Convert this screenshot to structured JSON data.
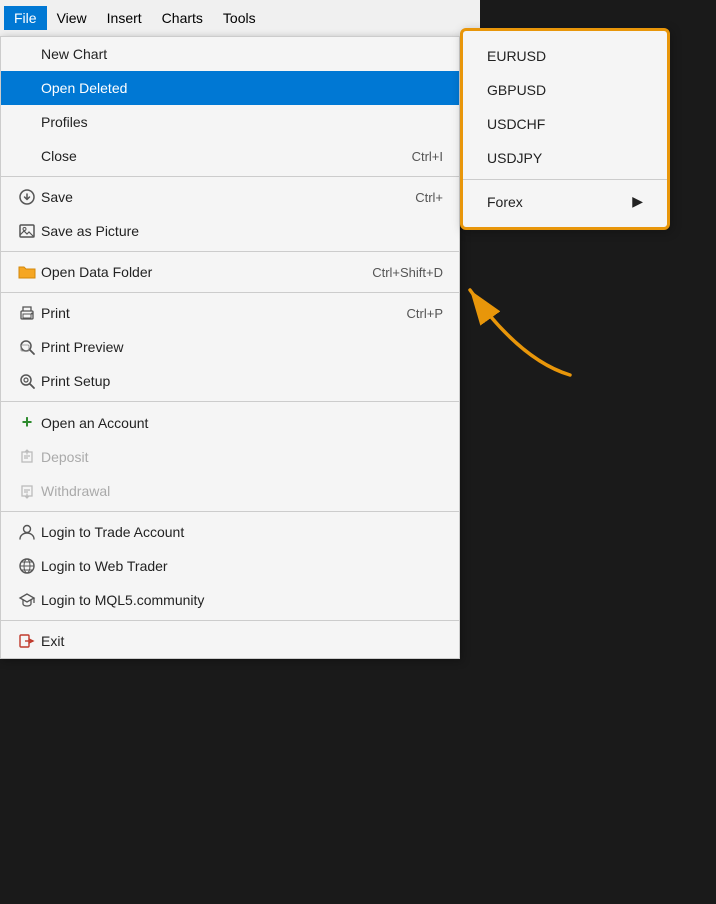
{
  "menubar": {
    "items": [
      {
        "label": "File",
        "active": true
      },
      {
        "label": "View",
        "active": false
      },
      {
        "label": "Insert",
        "active": false
      },
      {
        "label": "Charts",
        "active": false
      },
      {
        "label": "Tools",
        "active": false
      }
    ]
  },
  "dropdown": {
    "items": [
      {
        "id": "new-chart",
        "label": "New Chart",
        "shortcut": "",
        "icon": "",
        "selected": false,
        "disabled": false,
        "separator_after": false
      },
      {
        "id": "open-deleted",
        "label": "Open Deleted",
        "shortcut": "",
        "icon": "",
        "selected": true,
        "disabled": false,
        "separator_after": false
      },
      {
        "id": "profiles",
        "label": "Profiles",
        "shortcut": "",
        "icon": "",
        "selected": false,
        "disabled": false,
        "separator_after": false
      },
      {
        "id": "close",
        "label": "Close",
        "shortcut": "Ctrl+I",
        "icon": "",
        "selected": false,
        "disabled": false,
        "separator_after": true
      },
      {
        "id": "save",
        "label": "Save",
        "shortcut": "Ctrl+",
        "icon": "save",
        "selected": false,
        "disabled": false,
        "separator_after": false
      },
      {
        "id": "save-as-picture",
        "label": "Save as Picture",
        "shortcut": "",
        "icon": "image",
        "selected": false,
        "disabled": false,
        "separator_after": true
      },
      {
        "id": "open-data-folder",
        "label": "Open Data Folder",
        "shortcut": "Ctrl+Shift+D",
        "icon": "folder",
        "selected": false,
        "disabled": false,
        "separator_after": true
      },
      {
        "id": "print",
        "label": "Print",
        "shortcut": "Ctrl+P",
        "icon": "print",
        "selected": false,
        "disabled": false,
        "separator_after": false
      },
      {
        "id": "print-preview",
        "label": "Print Preview",
        "shortcut": "",
        "icon": "print-preview",
        "selected": false,
        "disabled": false,
        "separator_after": false
      },
      {
        "id": "print-setup",
        "label": "Print Setup",
        "shortcut": "",
        "icon": "print-setup",
        "selected": false,
        "disabled": false,
        "separator_after": true
      },
      {
        "id": "open-account",
        "label": "Open an Account",
        "shortcut": "",
        "icon": "plus",
        "selected": false,
        "disabled": false,
        "separator_after": false
      },
      {
        "id": "deposit",
        "label": "Deposit",
        "shortcut": "",
        "icon": "deposit",
        "selected": false,
        "disabled": true,
        "separator_after": false
      },
      {
        "id": "withdrawal",
        "label": "Withdrawal",
        "shortcut": "",
        "icon": "withdrawal",
        "selected": false,
        "disabled": true,
        "separator_after": true
      },
      {
        "id": "login-trade",
        "label": "Login to Trade Account",
        "shortcut": "",
        "icon": "user",
        "selected": false,
        "disabled": false,
        "separator_after": false
      },
      {
        "id": "login-web",
        "label": "Login to Web Trader",
        "shortcut": "",
        "icon": "globe",
        "selected": false,
        "disabled": false,
        "separator_after": false
      },
      {
        "id": "login-mql5",
        "label": "Login to MQL5.community",
        "shortcut": "",
        "icon": "graduation",
        "selected": false,
        "disabled": false,
        "separator_after": true
      },
      {
        "id": "exit",
        "label": "Exit",
        "shortcut": "",
        "icon": "exit",
        "selected": false,
        "disabled": false,
        "separator_after": false
      }
    ]
  },
  "submenu": {
    "items": [
      {
        "label": "EURUSD"
      },
      {
        "label": "GBPUSD"
      },
      {
        "label": "USDCHF"
      },
      {
        "label": "USDJPY"
      }
    ],
    "forex_label": "Forex"
  },
  "icons": {
    "save": "💾",
    "image": "🖼",
    "folder": "📁",
    "print": "🖨",
    "print-preview": "🔍",
    "print-setup": "🔧",
    "plus": "+",
    "deposit": "⬇",
    "withdrawal": "⬆",
    "user": "👤",
    "globe": "🌐",
    "graduation": "🎓",
    "exit": "🚪"
  }
}
